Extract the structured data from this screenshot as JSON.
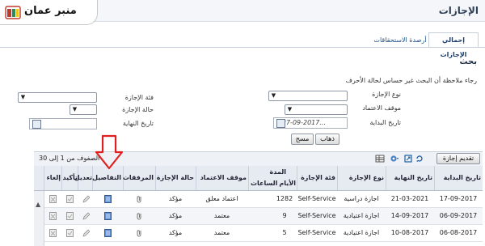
{
  "header": {
    "page_title": "الإجازات"
  },
  "brand": {
    "name": "منبر عمان"
  },
  "tabs": [
    {
      "label": "إجمالي الإجازات"
    },
    {
      "label": "أرصدة الاستحقاقات"
    }
  ],
  "search": {
    "title": "بحث",
    "hint": "رجاء ملاحظة أن البحث غير حساس لحالة الأحرف",
    "fields": {
      "leave_type": "نوع الإجازة",
      "approval_status": "موقف الاعتماد",
      "start_date": "تاريخ البداية",
      "leave_category": "فئة الإجازة",
      "leave_state": "حالة الإجازة",
      "end_date": "تاريخ النهاية"
    },
    "start_date_value": "(27-09-2017...",
    "go_label": "ذهاب",
    "clear_label": "مسح"
  },
  "grid": {
    "submit_label": "تقديم إجازة",
    "pager": "الصفوف من 1 إلى 30",
    "columns": {
      "start_date": "تاريخ البداية",
      "end_date": "تاريخ النهاية",
      "leave_type": "نوع الإجازة",
      "leave_category": "فئة الإجازة",
      "duration": "المدة",
      "days": "الأيام",
      "hours": "الساعات",
      "approval_status": "موقف الاعتماد",
      "leave_state": "حالة الإجازة",
      "attachments": "المرفقات",
      "details": "التفاصيل",
      "edit": "تعديل",
      "confirm": "تأكيد",
      "cancel": "إلغاء"
    },
    "rows": [
      {
        "start": "17-09-2017",
        "end": "21-03-2021",
        "type": "اجازة دراسية",
        "category": "Self-Service",
        "days": "1282",
        "hours": "",
        "approval": "اعتماد معلق",
        "state": "مؤكد"
      },
      {
        "start": "06-09-2017",
        "end": "14-09-2017",
        "type": "اجازة اعتيادية",
        "category": "Self-Service",
        "days": "9",
        "hours": "",
        "approval": "معتمد",
        "state": "مؤكد"
      },
      {
        "start": "06-08-2017",
        "end": "10-08-2017",
        "type": "اجازة اعتيادية",
        "category": "Self-Service",
        "days": "5",
        "hours": "",
        "approval": "معتمد",
        "state": "مؤكد"
      }
    ]
  },
  "colors": {
    "accent": "#1b4f8a",
    "annotation_arrow": "#e02020"
  }
}
